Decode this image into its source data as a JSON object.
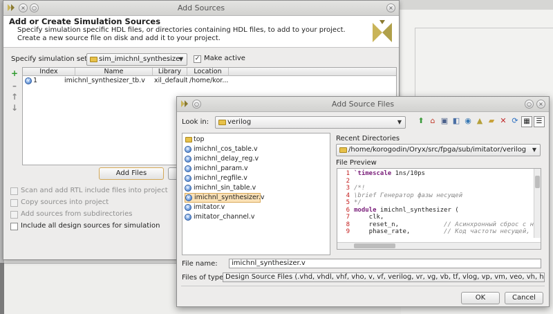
{
  "window1": {
    "title": "Add Sources",
    "heading": "Add or Create Simulation Sources",
    "description": "Specify simulation specific HDL files, or directories containing HDL files, to add to your project. Create a new source file on disk and add it to your project.",
    "simset_label": "Specify simulation set:",
    "simset_value": "sim_imichnl_synthesizer",
    "make_active_label": "Make active",
    "table": {
      "columns": [
        "Index",
        "Name",
        "Library",
        "Location"
      ],
      "rows": [
        {
          "index": "1",
          "name": "imichnl_synthesizer_tb.v",
          "library": "xil_defaultlib",
          "location": "/home/kor..."
        }
      ]
    },
    "add_files_label": "Add Files",
    "options": [
      {
        "label": "Scan and add RTL include files into project",
        "checked": false,
        "enabled": false
      },
      {
        "label": "Copy sources into project",
        "checked": false,
        "enabled": false
      },
      {
        "label": "Add sources from subdirectories",
        "checked": false,
        "enabled": false
      },
      {
        "label": "Include all design sources for simulation",
        "checked": false,
        "enabled": true
      }
    ]
  },
  "window2": {
    "title": "Add Source Files",
    "look_in_label": "Look in:",
    "look_in_value": "verilog",
    "recent_label": "Recent Directories",
    "recent_value": "/home/korogodin/Oryx/src/fpga/sub/imitator/verilog",
    "preview_label": "File Preview",
    "files": [
      {
        "name": "top",
        "type": "folder"
      },
      {
        "name": "imichnl_cos_table.v",
        "type": "verilog"
      },
      {
        "name": "imichnl_delay_reg.v",
        "type": "verilog"
      },
      {
        "name": "imichnl_param.v",
        "type": "verilog"
      },
      {
        "name": "imichnl_regfile.v",
        "type": "verilog"
      },
      {
        "name": "imichnl_sin_table.v",
        "type": "verilog"
      },
      {
        "name": "imichnl_synthesizer.v",
        "type": "verilog",
        "selected": true
      },
      {
        "name": "imitator.v",
        "type": "verilog"
      },
      {
        "name": "imitator_channel.v",
        "type": "verilog"
      }
    ],
    "preview_lines": [
      "1",
      "2",
      "3",
      "4",
      "5",
      "6",
      "7",
      "8",
      "9"
    ],
    "code": {
      "l1a": "`timescale",
      "l1b": " 1ns/10ps",
      "l3": "/*!",
      "l4": "\\brief Генератор фазы несущей",
      "l5": "*/",
      "l6a": "module",
      "l6b": " imichnl_synthesizer (",
      "l7": "    clk,",
      "l8a": "    reset_n,            ",
      "l8b": "// Асинхронный сброс с низк",
      "l9a": "    phase_rate,         ",
      "l9b": "// Код частоты несущей, кот"
    },
    "file_name_label": "File name:",
    "file_name_value": "imichnl_synthesizer.v",
    "files_of_type_label": "Files of type:",
    "files_of_type_value": "Design Source Files (.vhd, vhdl, vhf, vho, v, vf, verilog, vr, vg, vb, tf, vlog, vp, vm, veo, vh, h, svh, edn, e",
    "ok_label": "OK",
    "cancel_label": "Cancel"
  },
  "icons": [
    "vivado-logo-icon",
    "folder-icon",
    "verilog-file-icon",
    "add-icon",
    "remove-icon",
    "move-up-icon",
    "move-down-icon",
    "up-folder-icon",
    "home-icon",
    "desktop-icon",
    "project-icon",
    "network-icon",
    "vivado-icon",
    "new-folder-icon",
    "delete-icon",
    "refresh-icon",
    "list-view-icon",
    "details-view-icon"
  ],
  "colors": {
    "accent_logo": "#c9b458",
    "selection": "#fbe2b7",
    "line_number": "#c21a1a"
  }
}
